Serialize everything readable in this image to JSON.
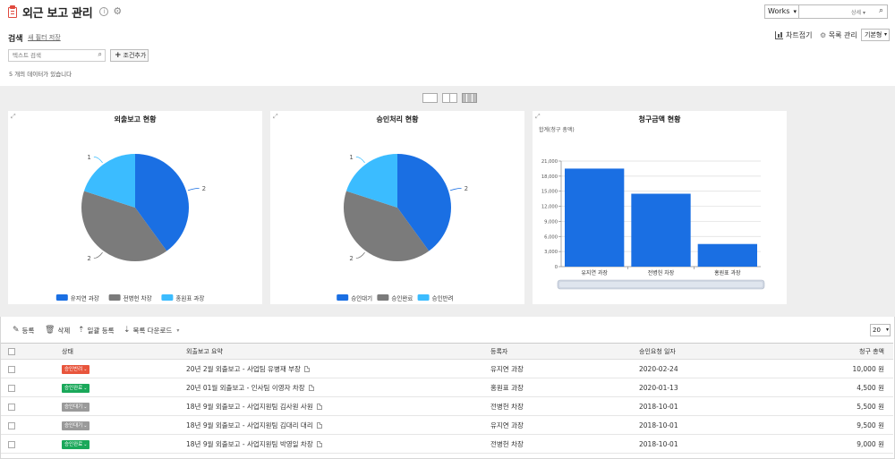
{
  "header": {
    "title": "외근 보고 관리",
    "works_select": "Works",
    "search_detail": "상세",
    "search_label": "검색",
    "new_filter": "새 필터 저장",
    "text_search_placeholder": "텍스트 검색",
    "add_condition": "조건추가",
    "count_message": "5 개의 데이터가 있습니다",
    "chart_fold": "차트접기",
    "list_manage": "목록 관리",
    "default_view": "기본형"
  },
  "charts": [
    {
      "title": "외출보고 현황",
      "type": "pie",
      "legend": [
        "유지연 과장",
        "전병헌 차장",
        "홍원표 과장"
      ],
      "values": [
        2,
        2,
        1
      ],
      "labels": [
        "2",
        "2",
        "1"
      ],
      "colors": [
        "#1a6fe3",
        "#7b7b7b",
        "#3bbcff"
      ]
    },
    {
      "title": "승인처리 현황",
      "type": "pie",
      "legend": [
        "승인대기",
        "승인완료",
        "승인반려"
      ],
      "values": [
        2,
        2,
        1
      ],
      "labels": [
        "2",
        "2",
        "1"
      ],
      "colors": [
        "#1a6fe3",
        "#7b7b7b",
        "#3bbcff"
      ]
    },
    {
      "title": "청구금액 현황",
      "type": "bar",
      "ylabel": "합계(청구 총액)",
      "categories": [
        "유지연 과장",
        "전병헌 차장",
        "홍원표 과장"
      ],
      "values": [
        19500,
        14500,
        4500
      ],
      "yticks": [
        "0",
        "3,000",
        "6,000",
        "9,000",
        "12,000",
        "15,000",
        "18,000",
        "21,000"
      ],
      "ylim": [
        0,
        21000
      ],
      "color": "#1a6fe3"
    }
  ],
  "chart_data": [
    {
      "type": "pie",
      "title": "외출보고 현황",
      "categories": [
        "유지연 과장",
        "전병헌 차장",
        "홍원표 과장"
      ],
      "values": [
        2,
        2,
        1
      ]
    },
    {
      "type": "pie",
      "title": "승인처리 현황",
      "categories": [
        "승인대기",
        "승인완료",
        "승인반려"
      ],
      "values": [
        2,
        2,
        1
      ]
    },
    {
      "type": "bar",
      "title": "청구금액 현황",
      "ylabel": "합계(청구 총액)",
      "categories": [
        "유지연 과장",
        "전병헌 차장",
        "홍원표 과장"
      ],
      "values": [
        19500,
        14500,
        4500
      ],
      "ylim": [
        0,
        21000
      ]
    }
  ],
  "toolbar": {
    "register": "등록",
    "delete": "삭제",
    "bulk_register": "일괄 등록",
    "list_download": "목록 다운로드",
    "page_size": "20"
  },
  "table": {
    "columns": [
      "상태",
      "외출보고 요약",
      "등록자",
      "승인요청 일자",
      "청구 총액"
    ],
    "rows": [
      {
        "status": "승인반려",
        "status_color": "#e8553c",
        "summary": "20년 2월 외출보고 - 사업팀 유병재 부장",
        "author": "유지연 과장",
        "date": "2020-02-24",
        "amount": "10,000 원"
      },
      {
        "status": "승인완료",
        "status_color": "#1aa85a",
        "summary": "20년 01월 외출보고 - 인사팀 이영자 차장",
        "author": "홍원표 과장",
        "date": "2020-01-13",
        "amount": "4,500 원"
      },
      {
        "status": "승인대기",
        "status_color": "#9a9a9a",
        "summary": "18년 9월 외출보고 - 사업지원팀 김사원 사원",
        "author": "전병헌 차장",
        "date": "2018-10-01",
        "amount": "5,500 원"
      },
      {
        "status": "승인대기",
        "status_color": "#9a9a9a",
        "summary": "18년 9월 외출보고 - 사업지원팀 김대리 대리",
        "author": "유지연 과장",
        "date": "2018-10-01",
        "amount": "9,500 원"
      },
      {
        "status": "승인완료",
        "status_color": "#1aa85a",
        "summary": "18년 9월 외출보고 - 사업지원팀 박영일 차장",
        "author": "전병헌 차장",
        "date": "2018-10-01",
        "amount": "9,000 원"
      }
    ]
  }
}
